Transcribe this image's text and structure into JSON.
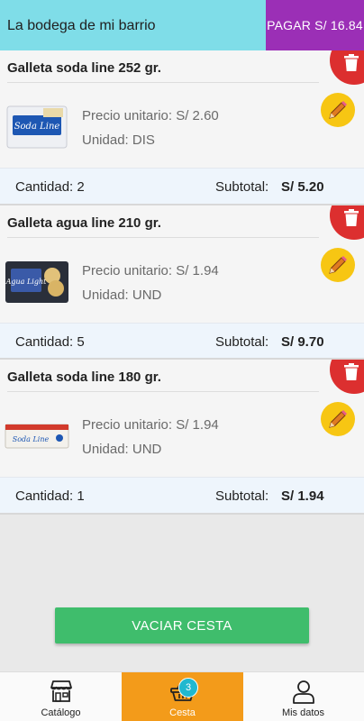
{
  "header": {
    "title": "La bodega de mi barrio",
    "pay_label": "PAGAR S/ 16.84"
  },
  "items": [
    {
      "name": "Galleta soda line 252 gr.",
      "price": "Precio unitario: S/ 2.60",
      "unit": "Unidad: DIS",
      "qty": "Cantidad: 2",
      "subtotal_label": "Subtotal:",
      "subtotal": "S/ 5.20",
      "pack_text": "Soda Line"
    },
    {
      "name": "Galleta agua line 210 gr.",
      "price": "Precio unitario: S/ 1.94",
      "unit": "Unidad: UND",
      "qty": "Cantidad: 5",
      "subtotal_label": "Subtotal:",
      "subtotal": "S/ 9.70",
      "pack_text": "Agua Light"
    },
    {
      "name": "Galleta soda line 180 gr.",
      "price": "Precio unitario: S/ 1.94",
      "unit": "Unidad: UND",
      "qty": "Cantidad: 1",
      "subtotal_label": "Subtotal:",
      "subtotal": "S/ 1.94",
      "pack_text": "Soda Line"
    }
  ],
  "empty_button": "VACIAR CESTA",
  "tabs": [
    {
      "label": "Catálogo",
      "icon": "store-icon"
    },
    {
      "label": "Cesta",
      "icon": "basket-icon",
      "badge": "3"
    },
    {
      "label": "Mis datos",
      "icon": "user-icon"
    }
  ],
  "colors": {
    "header": "#7fdde8",
    "pay": "#9b2fb6",
    "delete": "#dc2f2f",
    "edit": "#f7c613",
    "empty_button": "#3fbd6c",
    "active_tab": "#f39b1a",
    "badge": "#20b8cf"
  }
}
